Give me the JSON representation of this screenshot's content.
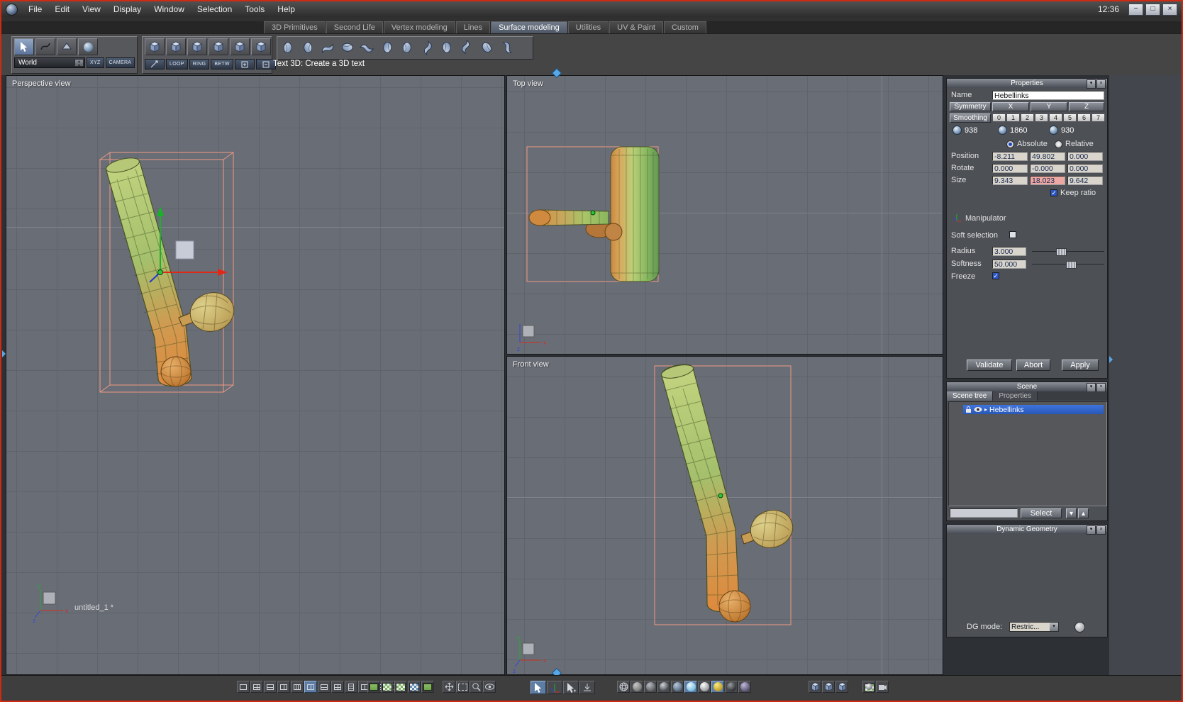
{
  "window": {
    "clock": "12:36"
  },
  "menubar": {
    "items": [
      "File",
      "Edit",
      "View",
      "Display",
      "Window",
      "Selection",
      "Tools",
      "Help"
    ]
  },
  "tabs": {
    "items": [
      "3D Primitives",
      "Second Life",
      "Vertex modeling",
      "Lines",
      "Surface modeling",
      "Utilities",
      "UV & Paint",
      "Custom"
    ],
    "active": "Surface modeling"
  },
  "toolbar": {
    "world": "World",
    "xyz": "XYZ",
    "camera": "CAMERA",
    "loop": "LOOP",
    "ring": "RING",
    "betw": "BETW",
    "status": "Text 3D: Create a 3D text"
  },
  "viewports": {
    "perspective": {
      "label": "Perspective view",
      "filename": "untitled_1 *"
    },
    "top": {
      "label": "Top view"
    },
    "front": {
      "label": "Front view"
    },
    "axis": {
      "x": "x",
      "y": "y",
      "z": "z"
    }
  },
  "properties": {
    "title": "Properties",
    "name_label": "Name",
    "name_value": "Hebellinks",
    "symmetry": "Symmetry",
    "axis_x": "X",
    "axis_y": "Y",
    "axis_z": "Z",
    "smoothing": "Smoothing",
    "levels": [
      "0",
      "1",
      "2",
      "3",
      "4",
      "5",
      "6",
      "7"
    ],
    "counts": [
      "938",
      "1860",
      "930"
    ],
    "absolute": "Absolute",
    "relative": "Relative",
    "position_label": "Position",
    "rotate_label": "Rotate",
    "size_label": "Size",
    "position": [
      "-8.211",
      "49.802",
      "0.000"
    ],
    "rotate": [
      "0.000",
      "-0.000",
      "0.000"
    ],
    "size": [
      "9.343",
      "18.023",
      "9.642"
    ],
    "keep_ratio": "Keep ratio",
    "manipulator": "Manipulator",
    "soft_selection": "Soft selection",
    "radius_label": "Radius",
    "radius": "3.000",
    "softness_label": "Softness",
    "softness": "50.000",
    "freeze": "Freeze",
    "validate": "Validate",
    "abort": "Abort",
    "apply": "Apply"
  },
  "scene": {
    "title": "Scene",
    "tab_tree": "Scene tree",
    "tab_props": "Properties",
    "item": "Hebellinks",
    "select": "Select"
  },
  "dg": {
    "title": "Dynamic Geometry",
    "mode_label": "DG mode:",
    "mode_value": "Restric..."
  }
}
